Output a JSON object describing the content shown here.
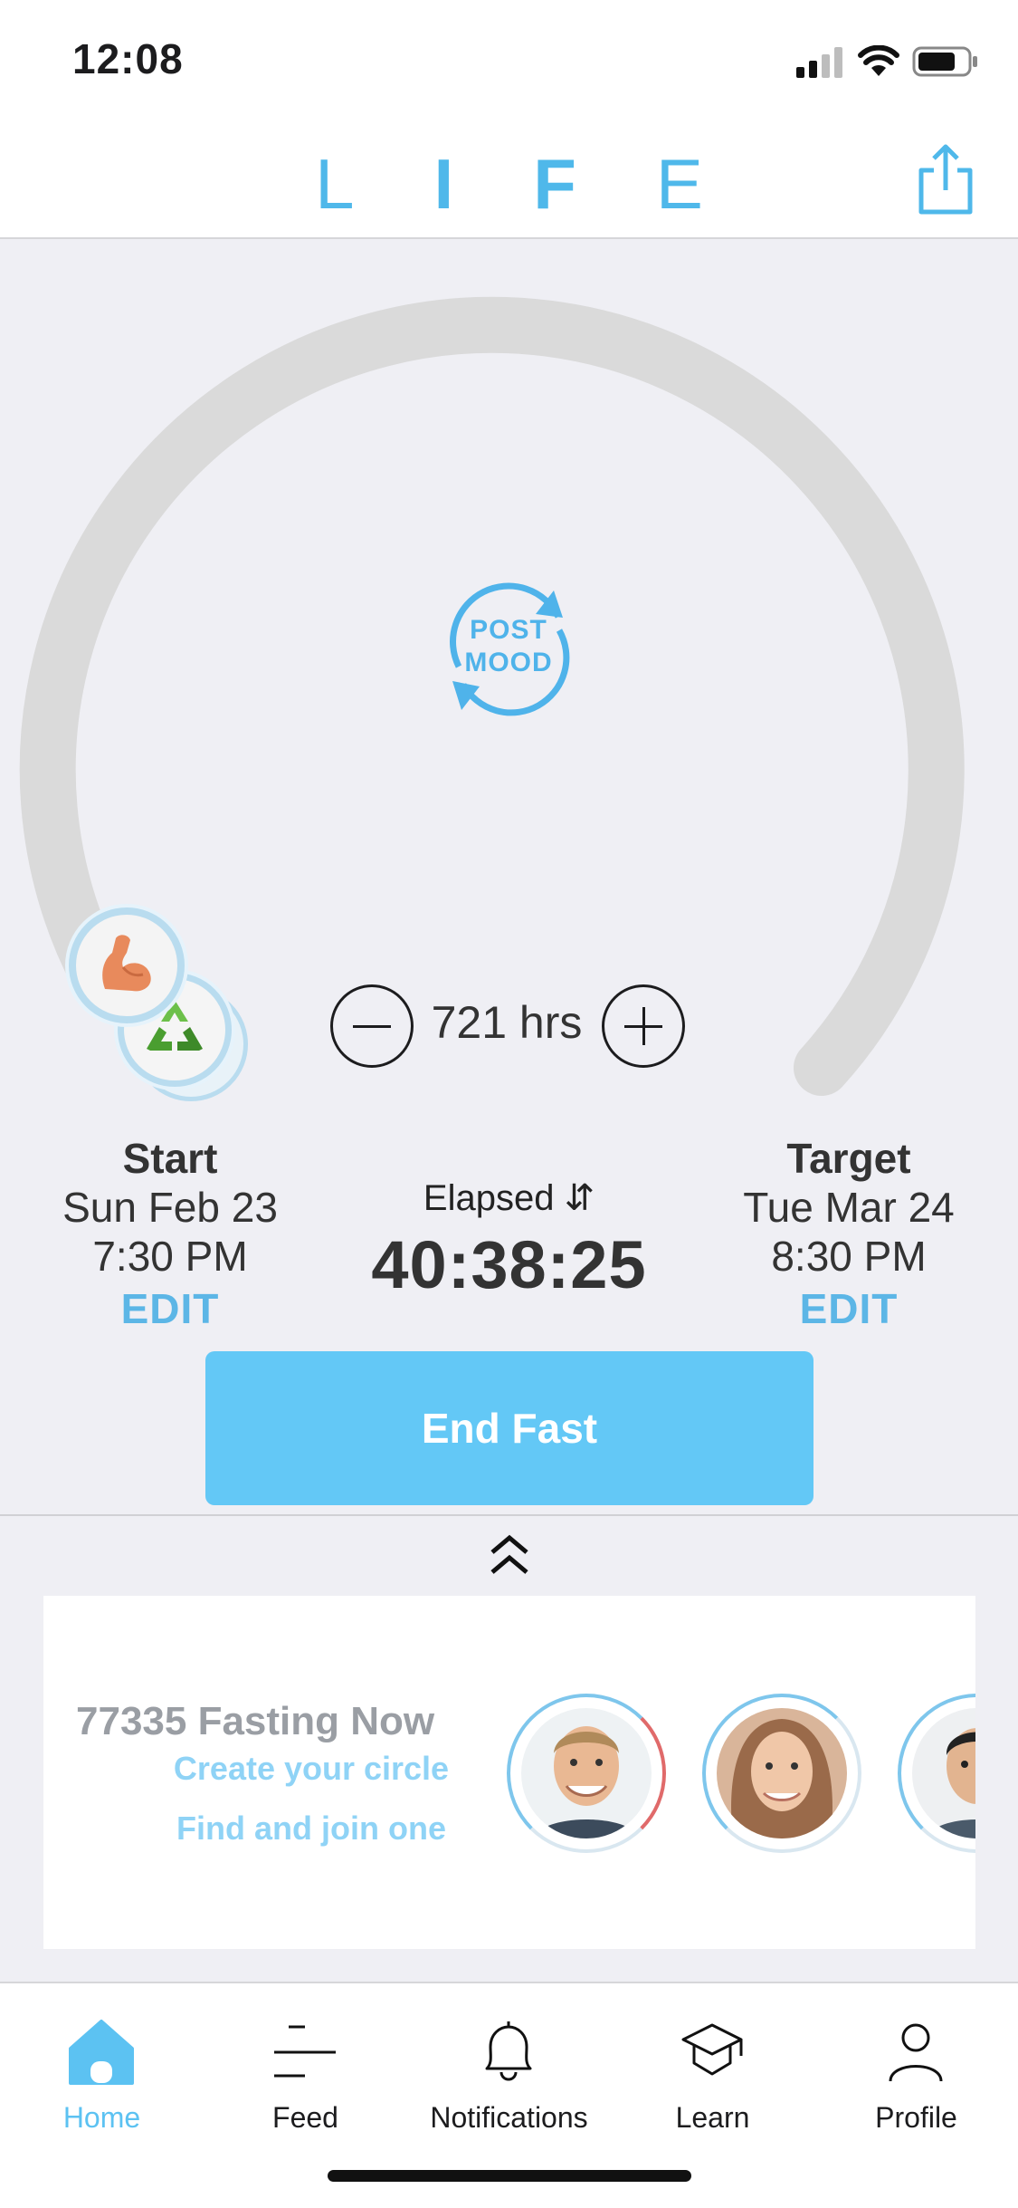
{
  "status_bar": {
    "time": "12:08"
  },
  "header": {
    "logo_letters": [
      "L",
      "I",
      "F",
      "E"
    ],
    "share_icon": "share-icon"
  },
  "timer": {
    "mood_label_line1": "POST",
    "mood_label_line2": "MOOD",
    "hours_label": "721 hrs",
    "start": {
      "label": "Start",
      "date": "Sun Feb 23",
      "time": "7:30 PM",
      "edit": "EDIT"
    },
    "target": {
      "label": "Target",
      "date": "Tue Mar 24",
      "time": "8:30 PM",
      "edit": "EDIT"
    },
    "elapsed_label": "Elapsed",
    "elapsed_value": "40:38:25",
    "end_button": "End Fast",
    "progress_fraction": 0.056
  },
  "circle_card": {
    "fasting_now": "77335 Fasting Now",
    "create_circle": "Create your circle",
    "find_join": "Find and join one"
  },
  "tabs": [
    {
      "label": "Home",
      "icon": "home-icon",
      "active": true
    },
    {
      "label": "Feed",
      "icon": "feed-icon",
      "active": false
    },
    {
      "label": "Notifications",
      "icon": "bell-icon",
      "active": false
    },
    {
      "label": "Learn",
      "icon": "graduation-cap-icon",
      "active": false
    },
    {
      "label": "Profile",
      "icon": "profile-icon",
      "active": false
    }
  ],
  "colors": {
    "accent": "#4fb8ea",
    "button": "#63c8f6",
    "ring": "#d9d9d9",
    "panel": "#efeff4"
  }
}
